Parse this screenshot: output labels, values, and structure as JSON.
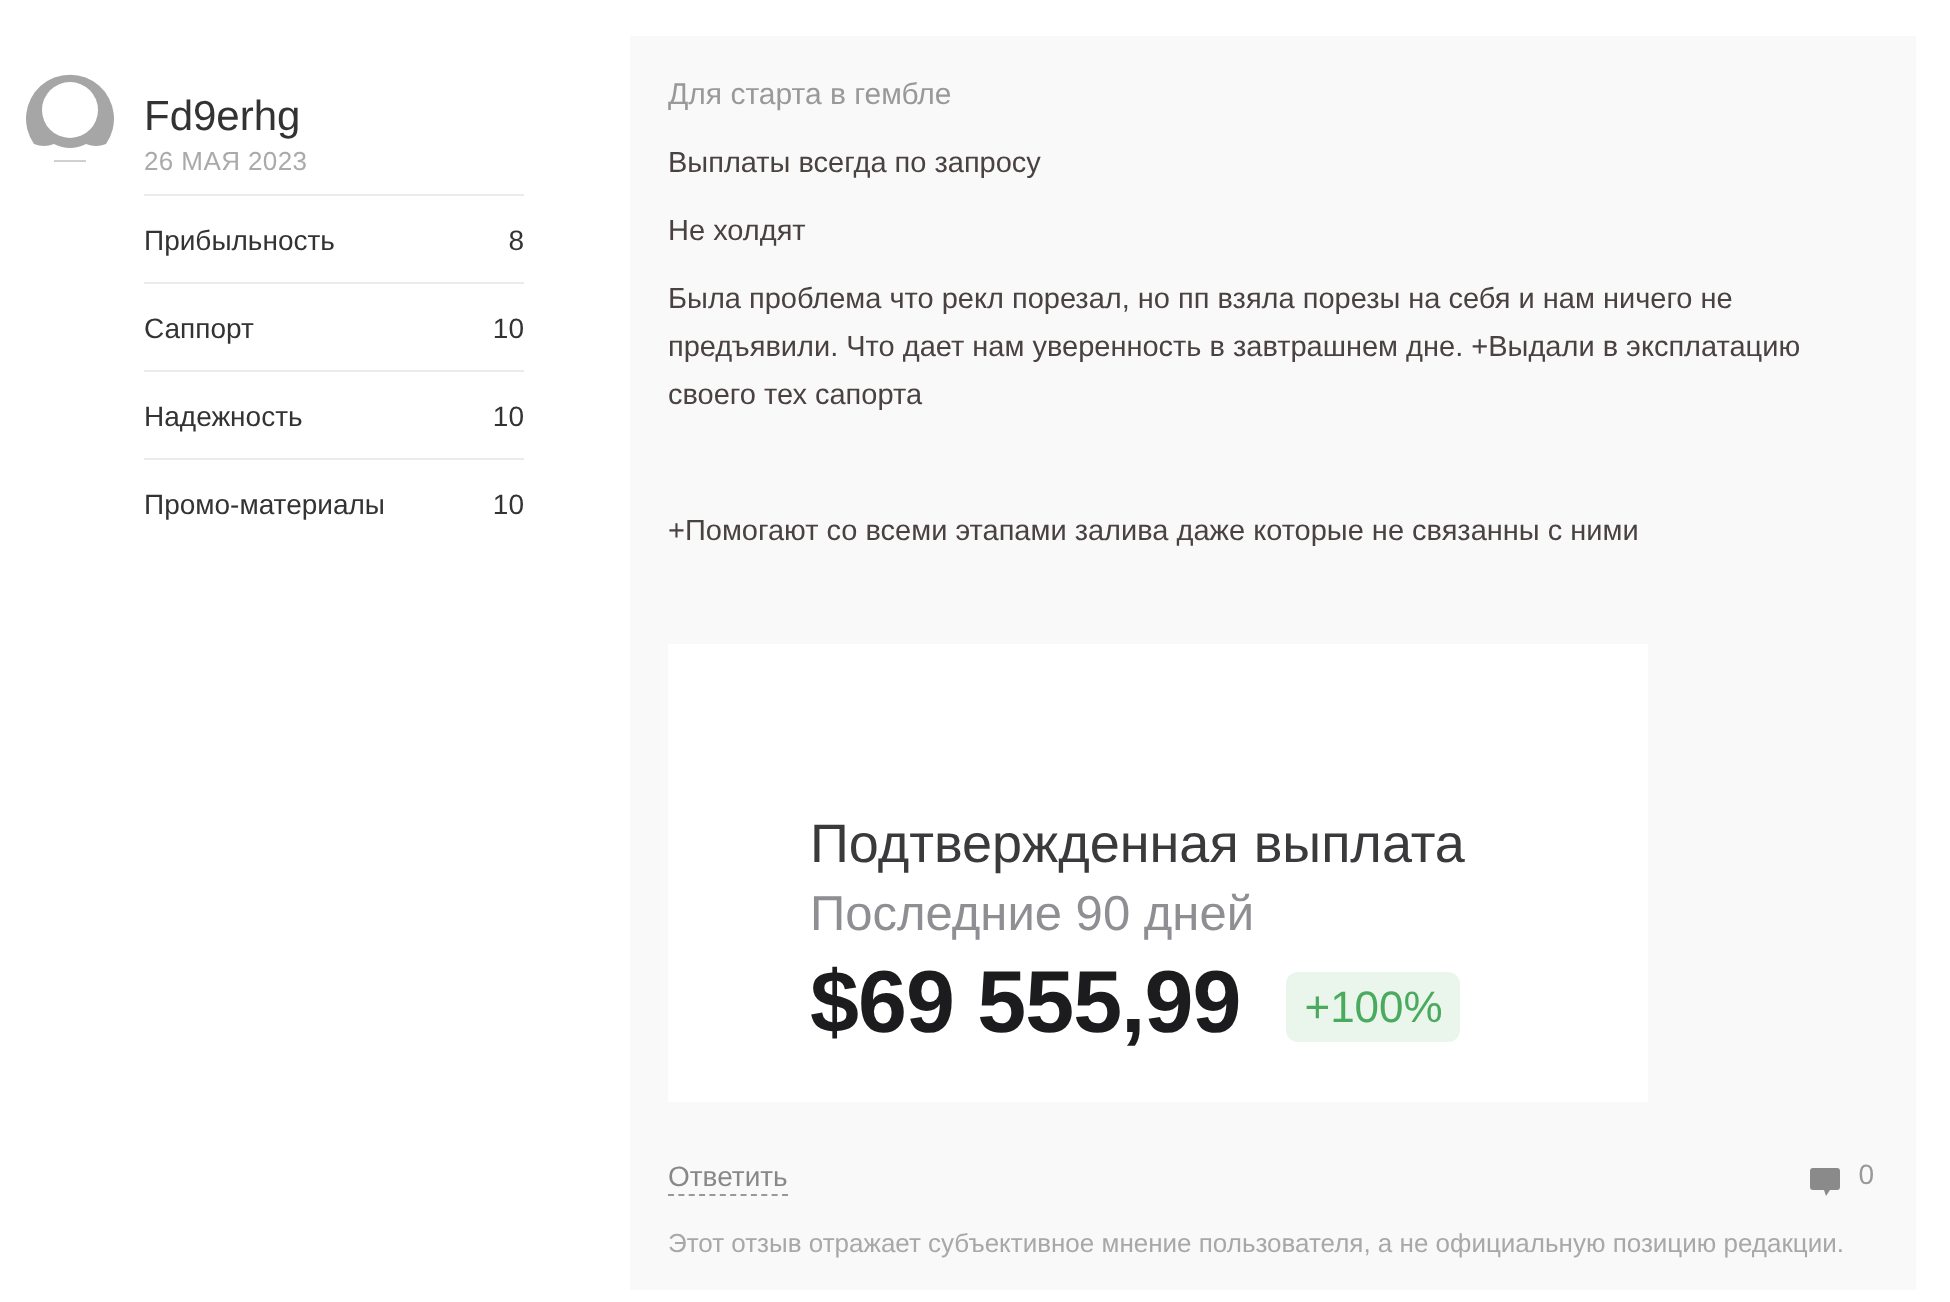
{
  "author": {
    "name": "Fd9erhg",
    "date": "26 МАЯ 2023"
  },
  "ratings": [
    {
      "label": "Прибыльность",
      "value": "8"
    },
    {
      "label": "Саппорт",
      "value": "10"
    },
    {
      "label": "Надежность",
      "value": "10"
    },
    {
      "label": "Промо-материалы",
      "value": "10"
    }
  ],
  "review": {
    "title": "Для старта в гембле",
    "paragraphs": [
      "Выплаты всегда по запросу",
      "Не холдят",
      "Была проблема что рекл порезал, но пп взяла порезы на себя и нам ничего не предъявили. Что дает нам уверенность в завтрашнем дне. +Выдали в эксплатацию своего тех сапорта"
    ],
    "closing_note": "+Помогают со всеми этапами залива даже которые не связанны с ними"
  },
  "attachment": {
    "title": "Подтвержденная выплата",
    "subtitle": "Последние 90 дней",
    "amount": "$69 555,99",
    "change": "+100%"
  },
  "footer": {
    "reply_link": "Ответить",
    "comment_count": "0",
    "disclaimer": "Этот отзыв отражает субъективное мнение пользователя, а не официальную позицию редакции."
  }
}
